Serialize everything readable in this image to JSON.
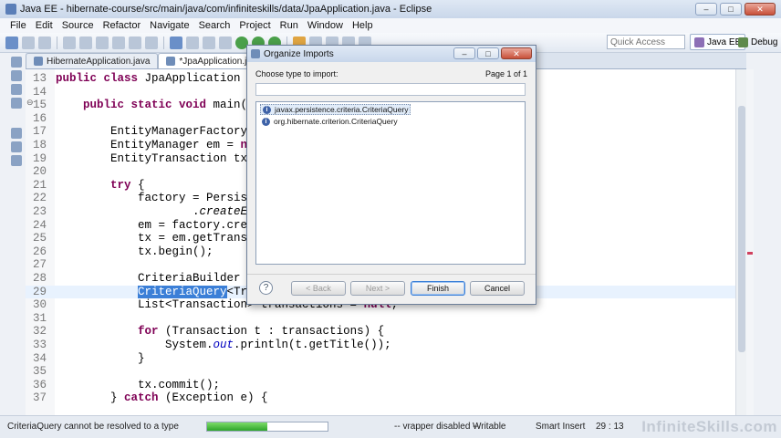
{
  "window": {
    "title": "Java EE - hibernate-course/src/main/java/com/infiniteskills/data/JpaApplication.java - Eclipse"
  },
  "menu": [
    "File",
    "Edit",
    "Source",
    "Refactor",
    "Navigate",
    "Search",
    "Project",
    "Run",
    "Window",
    "Help"
  ],
  "toolbar": {
    "quick_access_placeholder": "Quick Access",
    "perspectives": [
      "Java EE",
      "Debug"
    ]
  },
  "tabs": [
    {
      "label": "HibernateApplication.java"
    },
    {
      "label": "*JpaApplication.java"
    }
  ],
  "code_lines": [
    {
      "num": "13",
      "segments": [
        {
          "t": "public class",
          "c": "kw"
        },
        {
          "t": " JpaApplication {",
          "c": ""
        }
      ]
    },
    {
      "num": "14",
      "segments": []
    },
    {
      "num": "15",
      "marker": "⊖",
      "segments": [
        {
          "t": "    ",
          "c": ""
        },
        {
          "t": "public static void",
          "c": "kw"
        },
        {
          "t": " main(Str",
          "c": ""
        }
      ]
    },
    {
      "num": "16",
      "segments": []
    },
    {
      "num": "17",
      "segments": [
        {
          "t": "        EntityManagerFactory fa",
          "c": ""
        }
      ]
    },
    {
      "num": "18",
      "segments": [
        {
          "t": "        EntityManager em = ",
          "c": ""
        },
        {
          "t": "null",
          "c": "kw"
        }
      ]
    },
    {
      "num": "19",
      "segments": [
        {
          "t": "        EntityTransaction tx = ",
          "c": ""
        }
      ]
    },
    {
      "num": "20",
      "segments": []
    },
    {
      "num": "21",
      "segments": [
        {
          "t": "        ",
          "c": ""
        },
        {
          "t": "try",
          "c": "kw"
        },
        {
          "t": " {",
          "c": ""
        }
      ]
    },
    {
      "num": "22",
      "segments": [
        {
          "t": "            factory = Persisten",
          "c": ""
        }
      ]
    },
    {
      "num": "23",
      "segments": [
        {
          "t": "                    .",
          "c": ""
        },
        {
          "t": "createEnti",
          "c": "ital"
        }
      ]
    },
    {
      "num": "24",
      "segments": [
        {
          "t": "            em = factory.create",
          "c": ""
        }
      ]
    },
    {
      "num": "25",
      "segments": [
        {
          "t": "            tx = em.getTransact",
          "c": ""
        }
      ]
    },
    {
      "num": "26",
      "segments": [
        {
          "t": "            tx.begin();",
          "c": ""
        }
      ]
    },
    {
      "num": "27",
      "segments": []
    },
    {
      "num": "28",
      "segments": [
        {
          "t": "            CriteriaBuilder cb ",
          "c": ""
        }
      ]
    },
    {
      "num": "29",
      "current": true,
      "segments": [
        {
          "t": "            ",
          "c": ""
        },
        {
          "t": "CriteriaQuery",
          "c": "sel"
        },
        {
          "t": "<Trans",
          "c": ""
        },
        {
          "t": "                             ",
          "c": ""
        },
        {
          "t": "on.class);",
          "c": ""
        }
      ]
    },
    {
      "num": "30",
      "segments": [
        {
          "t": "            List<Transaction> transactions = ",
          "c": ""
        },
        {
          "t": "null",
          "c": "kw"
        },
        {
          "t": ";",
          "c": ""
        }
      ]
    },
    {
      "num": "31",
      "segments": []
    },
    {
      "num": "32",
      "segments": [
        {
          "t": "            ",
          "c": ""
        },
        {
          "t": "for",
          "c": "kw"
        },
        {
          "t": " (Transaction t : transactions) {",
          "c": ""
        }
      ]
    },
    {
      "num": "33",
      "segments": [
        {
          "t": "                System.",
          "c": ""
        },
        {
          "t": "out",
          "c": "fld"
        },
        {
          "t": ".println(t.getTitle());",
          "c": ""
        }
      ]
    },
    {
      "num": "34",
      "segments": [
        {
          "t": "            }",
          "c": ""
        }
      ]
    },
    {
      "num": "35",
      "segments": []
    },
    {
      "num": "36",
      "segments": [
        {
          "t": "            tx.commit();",
          "c": ""
        }
      ]
    },
    {
      "num": "37",
      "segments": [
        {
          "t": "        } ",
          "c": ""
        },
        {
          "t": "catch",
          "c": "kw"
        },
        {
          "t": " (Exception e) {",
          "c": ""
        }
      ]
    }
  ],
  "dialog": {
    "title": "Organize Imports",
    "prompt": "Choose type to import:",
    "page_info": "Page 1 of 1",
    "filter_value": "",
    "items": [
      {
        "label": "javax.persistence.criteria.CriteriaQuery",
        "selected": true
      },
      {
        "label": "org.hibernate.criterion.CriteriaQuery",
        "selected": false
      }
    ],
    "buttons": {
      "back": "< Back",
      "next": "Next >",
      "finish": "Finish",
      "cancel": "Cancel"
    }
  },
  "status": {
    "message": "CriteriaQuery cannot be resolved to a type",
    "progress": 0.5,
    "vrapper": "-- vrapper disabled --",
    "mode": "Writable",
    "insert": "Smart Insert",
    "position": "29 : 13"
  },
  "watermark": "InfiniteSkills.com"
}
